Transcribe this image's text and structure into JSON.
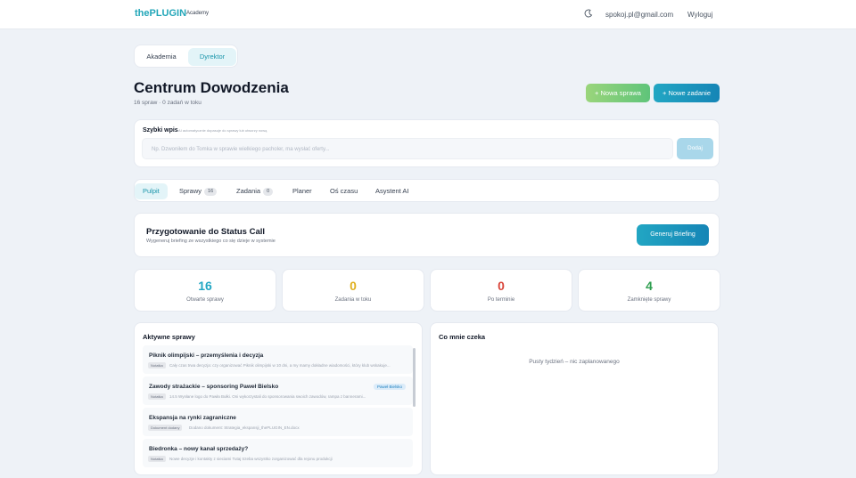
{
  "header": {
    "logo": "thePLUGIN",
    "logo_sub": "Academy",
    "theme_icon": "moon-icon",
    "user_email": "spokoj.pl@gmail.com",
    "logout_label": "Wyloguj"
  },
  "role_tabs": [
    {
      "label": "Akademia",
      "active": false
    },
    {
      "label": "Dyrektor",
      "active": true
    }
  ],
  "page": {
    "title": "Centrum Dowodzenia",
    "subtitle": "16 spraw · 0 zadań w toku"
  },
  "actions": {
    "new_case": "+ Nowa sprawa",
    "new_task": "+ Nowe zadanie"
  },
  "quick_entry": {
    "label": "Szybki wpis",
    "hint": "AI automatycznie dopasuje do sprawy lub utworzy nową",
    "placeholder": "Np. Dzwoniłem do Tomka w sprawie wielkiego pacholer, ma wysłać oferty...",
    "button": "Dodaj"
  },
  "nav": {
    "tabs": [
      {
        "label": "Pulpit",
        "badge": null,
        "active": true
      },
      {
        "label": "Sprawy",
        "badge": "16",
        "active": false
      },
      {
        "label": "Zadania",
        "badge": "0",
        "active": false
      },
      {
        "label": "Planer",
        "badge": null,
        "active": false
      },
      {
        "label": "Oś czasu",
        "badge": null,
        "active": false
      },
      {
        "label": "Asystent AI",
        "badge": null,
        "active": false
      }
    ]
  },
  "status_call": {
    "title": "Przygotowanie do Status Call",
    "subtitle": "Wygeneruj briefing ze wszystkiego co się dzieje w systemie",
    "button": "Generuj Briefing"
  },
  "stats": [
    {
      "value": "16",
      "label": "Otwarte sprawy",
      "color": "#22a6c3"
    },
    {
      "value": "0",
      "label": "Zadania w toku",
      "color": "#e0b020"
    },
    {
      "value": "0",
      "label": "Po terminie",
      "color": "#d9453a"
    },
    {
      "value": "4",
      "label": "Zamknięte sprawy",
      "color": "#2e9e4f"
    }
  ],
  "active_cases": {
    "title": "Aktywne sprawy",
    "items": [
      {
        "title": "Piknik olimpijski – przemyślenia i decyzja",
        "tag": "Notatka",
        "desc": "Cały czas trwa decyzja: czy organizować Piknik olimpijski w 10 dni, a my mamy dokładne wiadomości, który klub wskakuje...",
        "pill": null
      },
      {
        "title": "Zawody strażackie – sponsoring Paweł Bielsko",
        "tag": "Notatka",
        "desc": "14.5 Wysłane logo do Pawła Bułki. Oni wykorzystali do sponsorowania swoich zawodów, rampa z bannerami...",
        "pill": "Paweł Bielsko"
      },
      {
        "title": "Ekspansja na rynki zagraniczne",
        "tag": "Dokument dodany",
        "desc": "Dodano dokument: Strategia_ekspansji_thePLUGIN_EN.docx",
        "pill": null
      },
      {
        "title": "Biedronka – nowy kanał sprzedaży?",
        "tag": "Notatka",
        "desc": "Nowe decyzje i kontakty z sieciami Tutaj trzeba wszystko zorganizować dla rejonu produkcji",
        "pill": null
      }
    ]
  },
  "waiting": {
    "title": "Co mnie czeka",
    "empty": "Pusty tydzień – nic zaplanowanego"
  }
}
